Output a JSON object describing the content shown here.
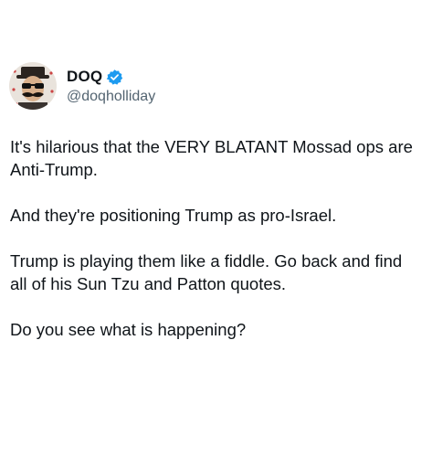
{
  "author": {
    "display_name": "DOQ",
    "handle": "@doqholliday",
    "verified": true,
    "avatar_icon": "avatar-mustache-sunglasses",
    "verified_color": "#1d9bf0"
  },
  "tweet": {
    "paragraphs": [
      "It's hilarious that the VERY BLATANT Mossad ops are Anti-Trump.",
      "And they're positioning Trump as pro-Israel.",
      "Trump is playing them like a fiddle. Go back and find all of his Sun Tzu and Patton quotes.",
      "Do you see what is happening?"
    ]
  }
}
